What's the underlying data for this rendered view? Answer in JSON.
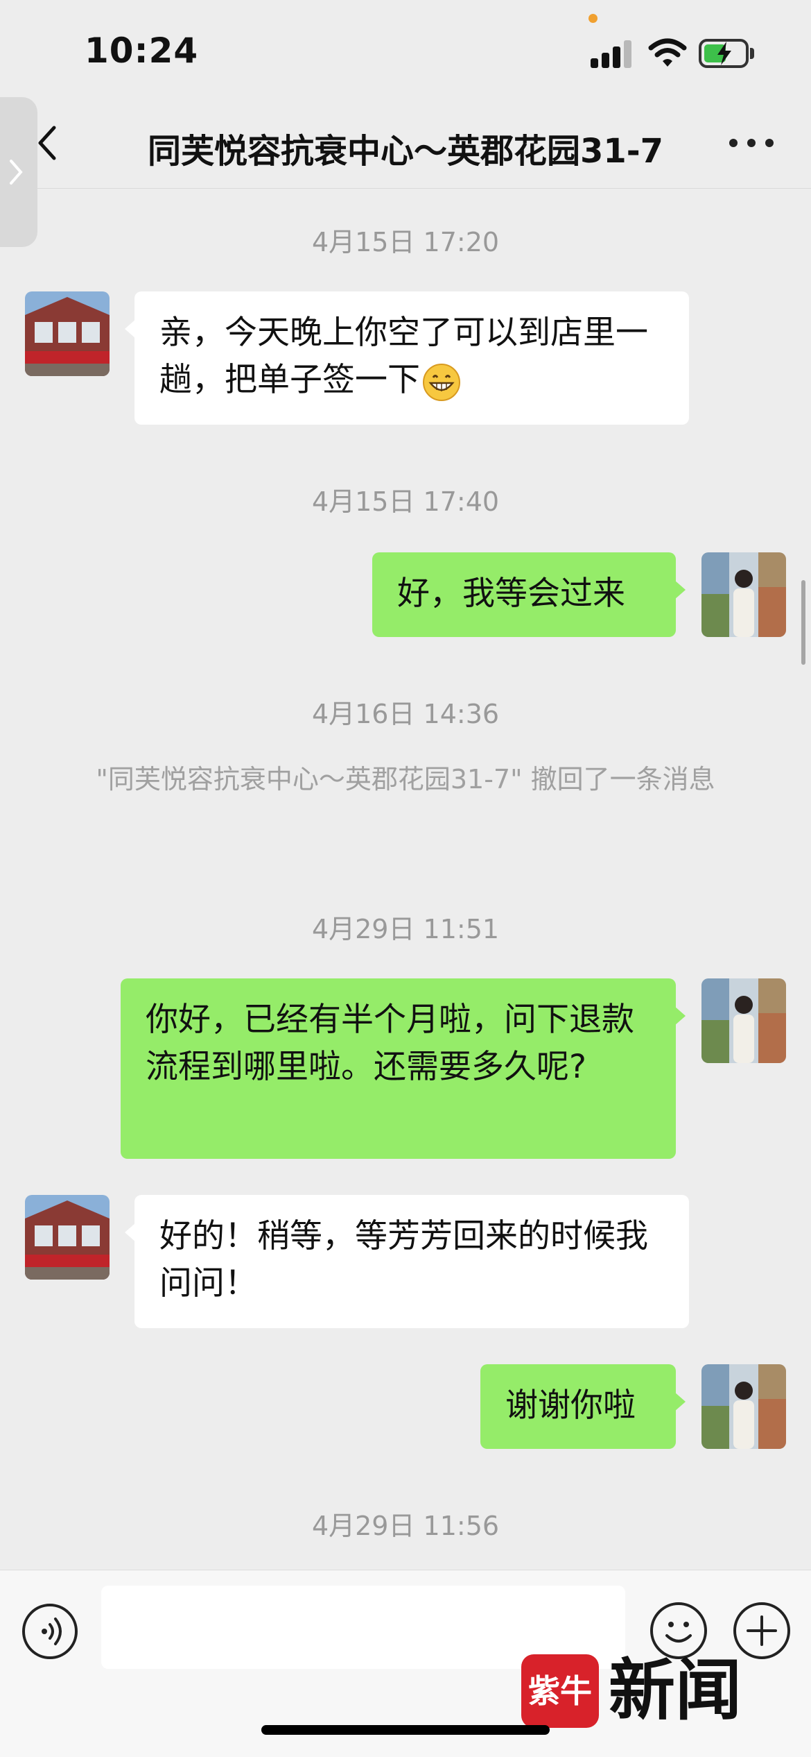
{
  "status_bar": {
    "time": "10:24",
    "battery_level": 0.55,
    "battery_color": "#3dc04a"
  },
  "nav": {
    "title": "同芙悦容抗衰中心～英郡花园31-7",
    "back_icon": "chevron-left-icon",
    "more_icon": "more-dots-icon"
  },
  "colors": {
    "background": "#ededed",
    "incoming_bubble": "#ffffff",
    "outgoing_bubble": "#95ec69",
    "timestamp_text": "#999999"
  },
  "messages": [
    {
      "type": "timestamp",
      "text": "4月15日 17:20"
    },
    {
      "type": "incoming",
      "text": "亲，今天晚上你空了可以到店里一趟，把单子签一下",
      "emoji": "grinning-face"
    },
    {
      "type": "timestamp",
      "text": "4月15日 17:40"
    },
    {
      "type": "outgoing",
      "text": "好，我等会过来"
    },
    {
      "type": "timestamp",
      "text": "4月16日 14:36"
    },
    {
      "type": "system",
      "text": "\"同芙悦容抗衰中心～英郡花园31-7\" 撤回了一条消息"
    },
    {
      "type": "timestamp",
      "text": "4月29日 11:51"
    },
    {
      "type": "outgoing",
      "text": "你好，已经有半个月啦，问下退款流程到哪里啦。还需要多久呢?"
    },
    {
      "type": "incoming",
      "text": "好的！稍等，等芳芳回来的时候我问问！"
    },
    {
      "type": "outgoing",
      "text": "谢谢你啦"
    },
    {
      "type": "timestamp",
      "text": "4月29日 11:56"
    }
  ],
  "input_bar": {
    "voice_icon": "voice-icon",
    "emoji_icon": "smiley-icon",
    "plus_icon": "plus-icon",
    "text_value": ""
  },
  "watermark": {
    "logo_text": "紫牛",
    "text": "新闻"
  }
}
